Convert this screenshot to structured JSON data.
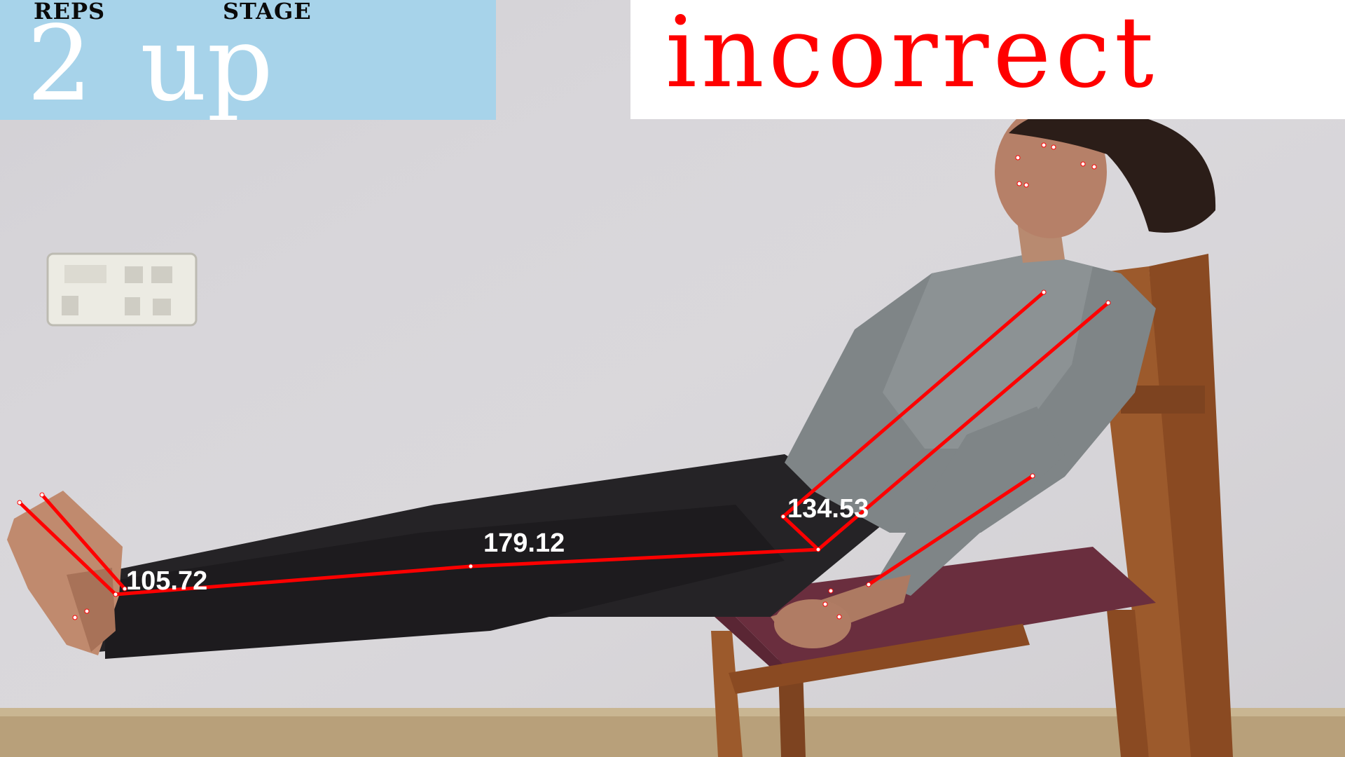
{
  "status_panel": {
    "reps_label": "REPS",
    "stage_label": "STAGE",
    "reps_value": "2",
    "stage_value": "up",
    "background": "#a7d3ea"
  },
  "feedback": {
    "text": "incorrect",
    "color": "#ff0000",
    "background": "#ffffff"
  },
  "angles": {
    "ankle": "105.72",
    "knee": "179.12",
    "hip": "134.53"
  },
  "skeleton": {
    "line_color": "#ff0000",
    "keypoint_color": "#ffffff"
  }
}
